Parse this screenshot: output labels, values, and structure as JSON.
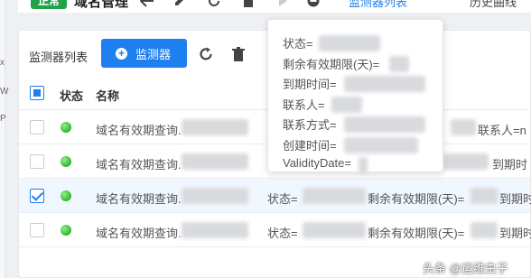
{
  "left_strip": {
    "chars": [
      "x",
      "W",
      "P"
    ]
  },
  "topbar": {
    "status_pill": "正常",
    "title": "域名管理",
    "link": "监测器列表",
    "history": "历史曲线",
    "icons": [
      "back-arrow-icon",
      "edit-icon",
      "refresh-icon",
      "delete-icon",
      "play-icon",
      "stop-icon"
    ]
  },
  "toolbar": {
    "title": "监测器列表",
    "add_label": "监测器"
  },
  "table": {
    "headers": {
      "status": "状态",
      "name": "名称"
    },
    "rows": [
      {
        "name": "域名有效期查询.",
        "info": "联系人=n",
        "checked": false
      },
      {
        "name": "域名有效期查询.",
        "info": "到期时",
        "checked": false
      },
      {
        "name": "域名有效期查询.",
        "info_a": "状态=",
        "info_b": "剩余有效期限(天)=",
        "info_c": "到期时",
        "checked": true
      },
      {
        "name": "域名有效期查询.",
        "info_a": "状态=",
        "info_b": "剩余有效期限(天)=",
        "info_c": "到期时",
        "checked": false
      }
    ]
  },
  "tooltip": {
    "lines": [
      "状态=",
      "剩余有效期限(天)=",
      "到期时间=",
      "联系人=",
      "联系方式=",
      "创建时间=",
      "ValidityDate="
    ]
  },
  "watermark": "头条 @运维虫子",
  "colors": {
    "primary": "#1e7ff0",
    "success": "#22a34a"
  }
}
